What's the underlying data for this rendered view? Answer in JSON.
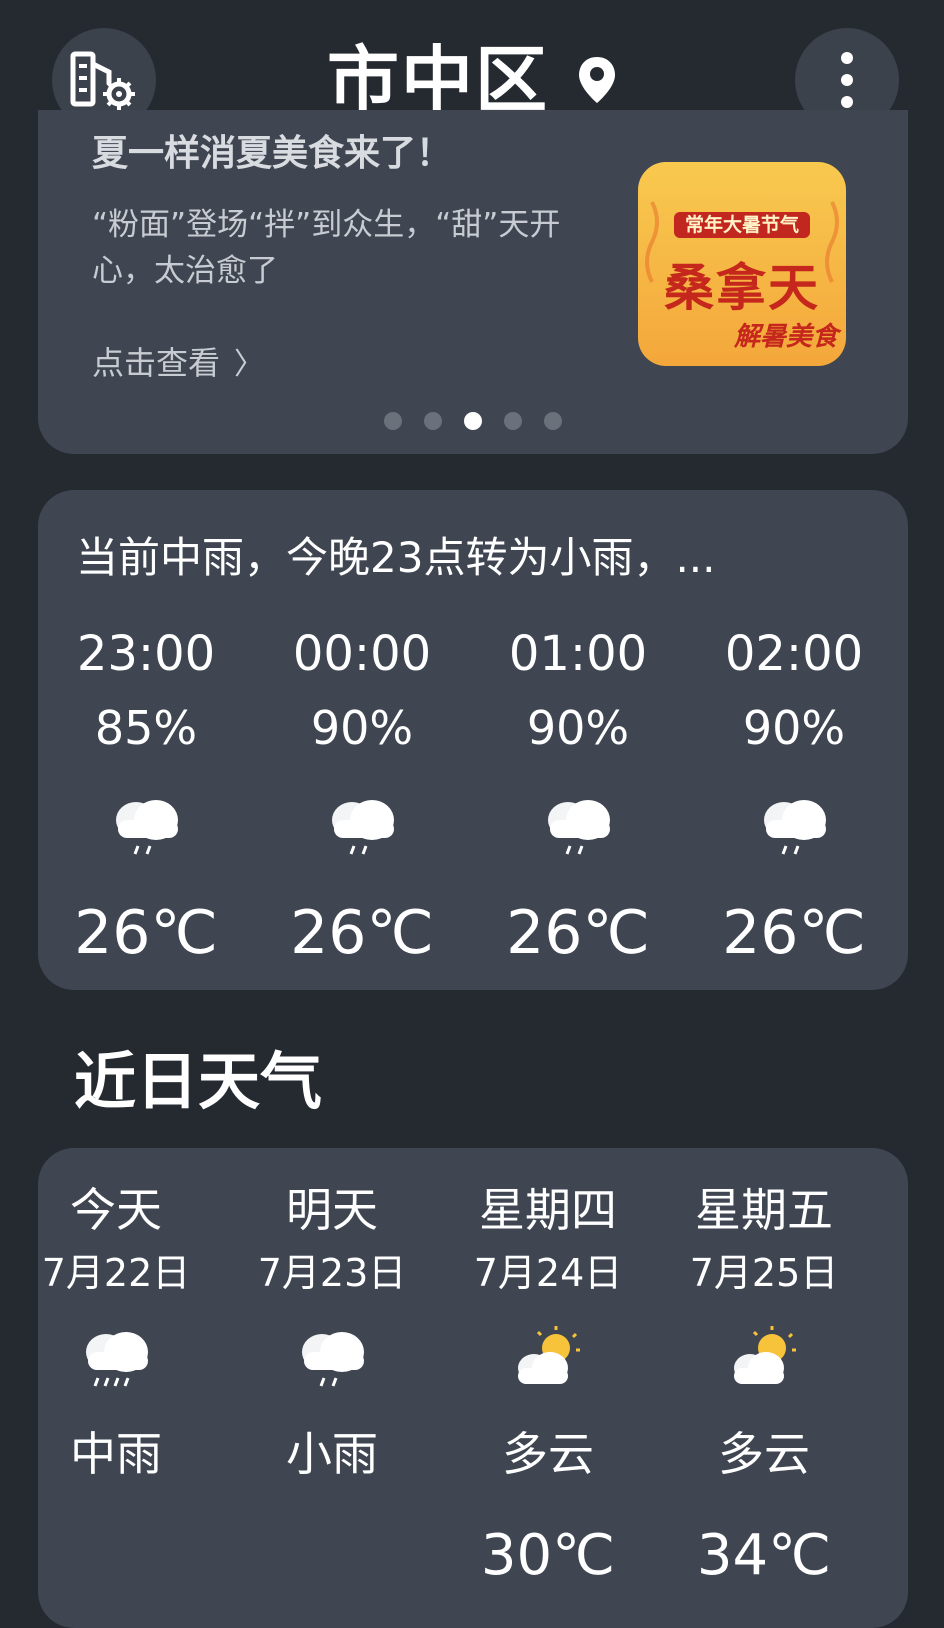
{
  "header": {
    "city": "市中区",
    "left_icon": "city-settings-icon",
    "location_icon": "location-pin-icon",
    "menu_icon": "more-vertical-icon"
  },
  "promo": {
    "title": "夏一样消夏美食来了！",
    "description": "“粉面”登场“拌”到众生，“甜”天开心，太治愈了",
    "link_label": "点击查看",
    "image_tag": "常年大暑节气",
    "image_title": "桑拿天",
    "image_subtitle": "解暑美食",
    "carousel_total": 5,
    "carousel_active": 3
  },
  "hourly": {
    "summary": "当前中雨，今晚23点转为小雨，...",
    "items": [
      {
        "time": "23:00",
        "probability": "85%",
        "icon": "light-rain-icon",
        "temp": "26℃"
      },
      {
        "time": "00:00",
        "probability": "90%",
        "icon": "light-rain-icon",
        "temp": "26℃"
      },
      {
        "time": "01:00",
        "probability": "90%",
        "icon": "light-rain-icon",
        "temp": "26℃"
      },
      {
        "time": "02:00",
        "probability": "90%",
        "icon": "light-rain-icon",
        "temp": "26℃"
      }
    ]
  },
  "daily": {
    "title": "近日天气",
    "items": [
      {
        "day": "今天",
        "date": "7月22日",
        "icon": "moderate-rain-icon",
        "condition": "中雨",
        "high": ""
      },
      {
        "day": "明天",
        "date": "7月23日",
        "icon": "light-rain-icon",
        "condition": "小雨",
        "high": ""
      },
      {
        "day": "星期四",
        "date": "7月24日",
        "icon": "partly-cloudy-icon",
        "condition": "多云",
        "high": "30℃"
      },
      {
        "day": "星期五",
        "date": "7月25日",
        "icon": "partly-cloudy-icon",
        "condition": "多云",
        "high": "34℃"
      }
    ]
  },
  "colors": {
    "background": "#252a31",
    "card": "#3f4651",
    "header_button": "#3c424b",
    "sun": "#f7c33a"
  }
}
